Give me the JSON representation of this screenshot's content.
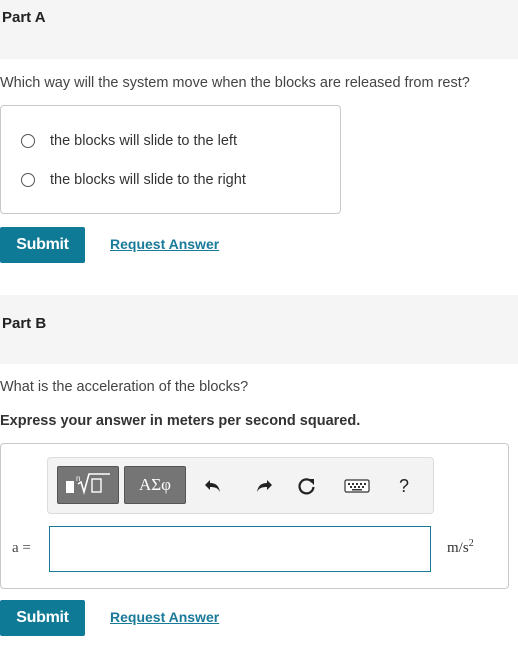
{
  "part_a": {
    "title": "Part A",
    "question": "Which way will the system move when the blocks are released from rest?",
    "options": [
      {
        "label": "the blocks will slide to the left",
        "selected": false
      },
      {
        "label": "the blocks will slide to the right",
        "selected": false
      }
    ],
    "submit_label": "Submit",
    "request_answer_label": "Request Answer"
  },
  "part_b": {
    "title": "Part B",
    "question": "What is the acceleration of the blocks?",
    "instruction": "Express your answer in meters per second squared.",
    "toolbar": {
      "templates_icon": "templates-icon",
      "symbols_label": "ΑΣφ",
      "undo_icon": "undo-icon",
      "redo_icon": "redo-icon",
      "reset_icon": "reset-icon",
      "keyboard_icon": "keyboard-icon",
      "help_label": "?"
    },
    "variable_label": "a =",
    "answer_value": "",
    "units_base": "m/s",
    "units_exp": "2",
    "submit_label": "Submit",
    "request_answer_label": "Request Answer"
  },
  "colors": {
    "accent": "#0f7a95",
    "link": "#1a7a9a",
    "header_bg": "#f5f5f5",
    "toolbar_button": "#757575"
  }
}
